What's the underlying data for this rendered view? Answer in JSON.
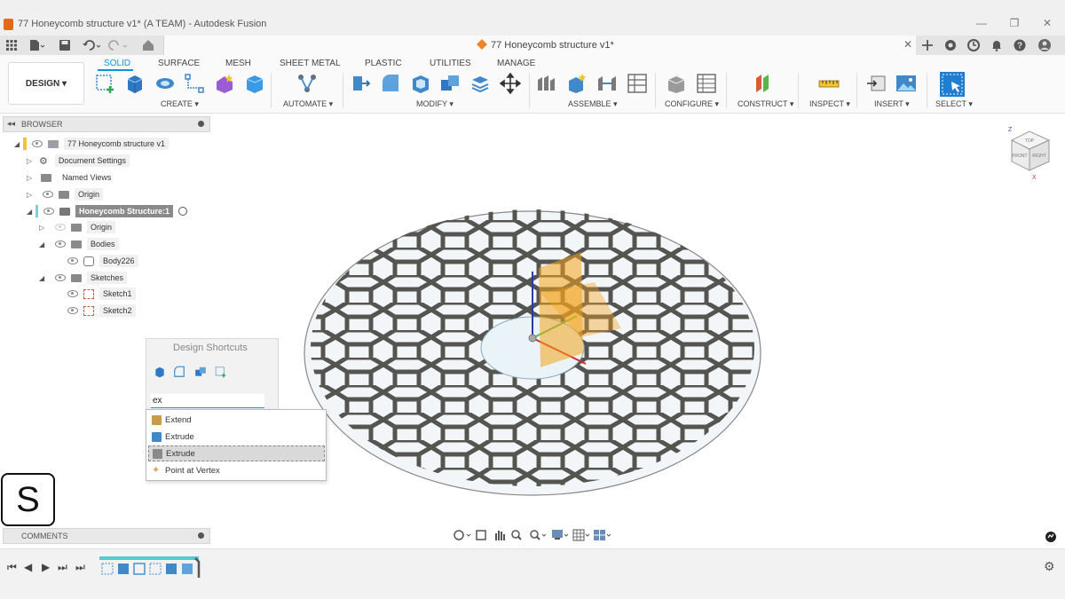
{
  "window": {
    "title": "77 Honeycomb structure v1* (A TEAM) - Autodesk Fusion",
    "minimize": "—",
    "maximize": "❐",
    "close": "✕"
  },
  "document_tab": {
    "title": "77 Honeycomb structure v1*",
    "close": "✕"
  },
  "workspace": {
    "label": "DESIGN ▾"
  },
  "ribbon_tabs": [
    "SOLID",
    "SURFACE",
    "MESH",
    "SHEET METAL",
    "PLASTIC",
    "UTILITIES",
    "MANAGE"
  ],
  "ribbon_groups": [
    "CREATE ▾",
    "AUTOMATE ▾",
    "MODIFY ▾",
    "ASSEMBLE ▾",
    "CONFIGURE ▾",
    "CONSTRUCT ▾",
    "INSPECT ▾",
    "INSERT ▾",
    "SELECT ▾"
  ],
  "browser": {
    "title": "BROWSER",
    "items": [
      {
        "label": "77 Honeycomb structure v1"
      },
      {
        "label": "Document Settings"
      },
      {
        "label": "Named Views"
      },
      {
        "label": "Origin"
      },
      {
        "label": "Honeycomb Structure:1"
      },
      {
        "label": "Origin"
      },
      {
        "label": "Bodies"
      },
      {
        "label": "Body226"
      },
      {
        "label": "Sketches"
      },
      {
        "label": "Sketch1"
      },
      {
        "label": "Sketch2"
      }
    ]
  },
  "shortcuts": {
    "title": "Design Shortcuts",
    "input_value": "ex",
    "results": [
      {
        "label": "Extend",
        "color": "#c99a48"
      },
      {
        "label": "Extrude",
        "color": "#3f88c9"
      },
      {
        "label": "Extrude",
        "color": "#8a8a8a"
      },
      {
        "label": "Point at Vertex",
        "color": "#e0a050"
      }
    ],
    "selected_index": 2
  },
  "comments": {
    "title": "COMMENTS"
  },
  "logo": {
    "letter": "S"
  },
  "viewcube": {
    "top": "TOP",
    "front": "FRONT",
    "right": "RIGHT",
    "axis_z": "Z",
    "axis_x": "X"
  },
  "colors": {
    "accent": "#0696d7",
    "hex_wall": "#5b5b57",
    "hex_wall_top": "#3b3b39",
    "selection_orange": "#f2a31b",
    "panel_bg": "#f0f0f0"
  }
}
